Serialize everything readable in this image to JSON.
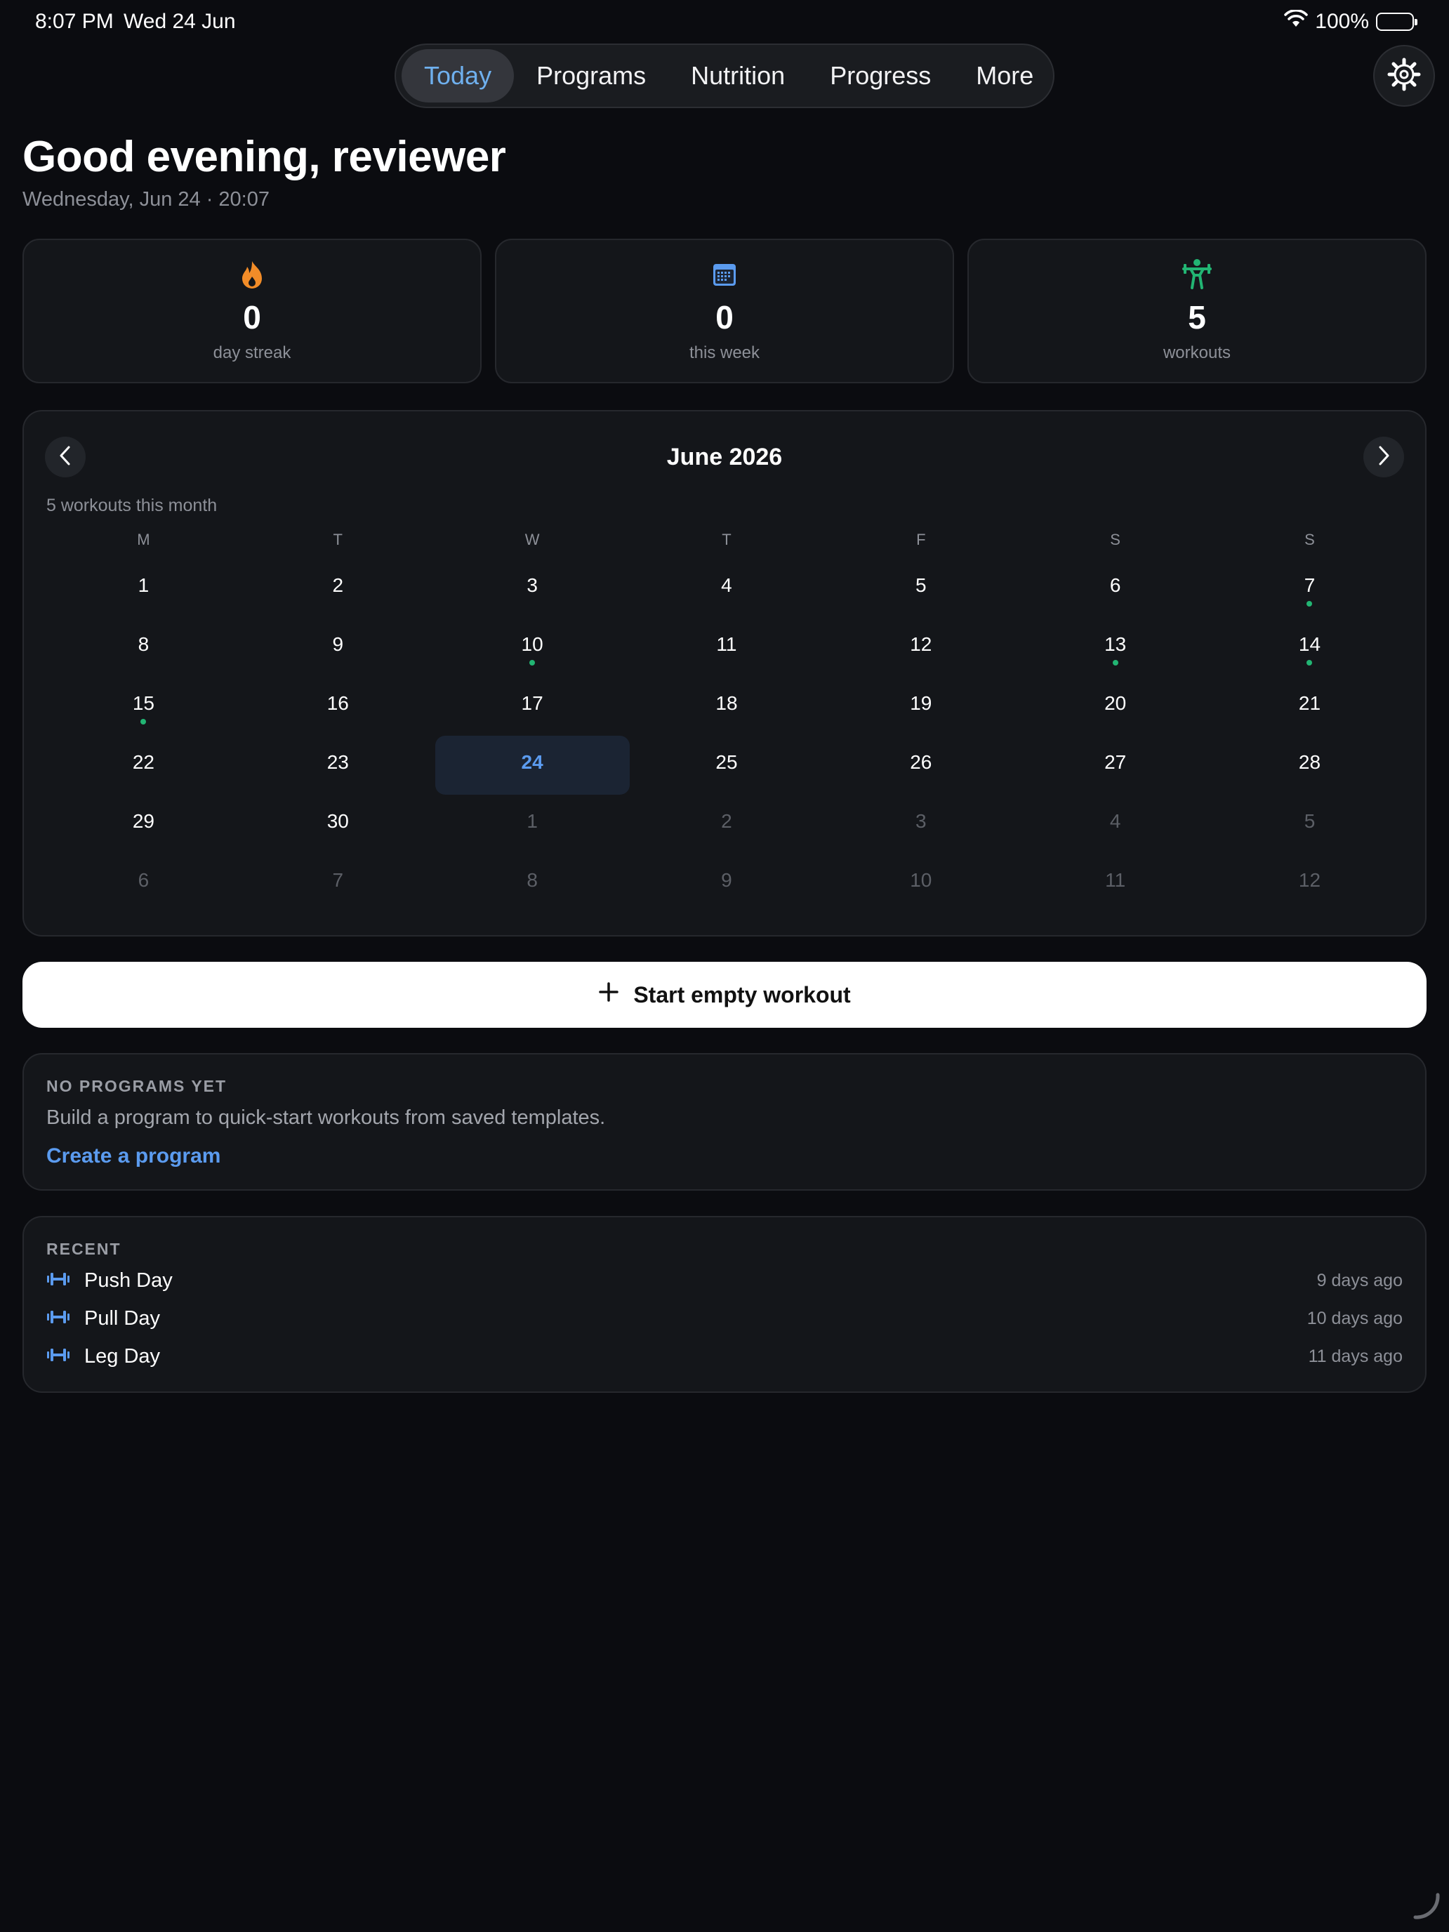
{
  "status": {
    "time": "8:07 PM",
    "date": "Wed 24 Jun",
    "battery": "100%"
  },
  "tabs": [
    {
      "label": "Today",
      "active": true
    },
    {
      "label": "Programs"
    },
    {
      "label": "Nutrition"
    },
    {
      "label": "Progress"
    },
    {
      "label": "More"
    }
  ],
  "header": {
    "greeting": "Good evening, reviewer",
    "date_line": "Wednesday, Jun 24 · 20:07"
  },
  "stats": [
    {
      "icon": "flame-icon",
      "value": "0",
      "label": "day streak",
      "color": "#f28c28"
    },
    {
      "icon": "calendar-icon",
      "value": "0",
      "label": "this week",
      "color": "#5b9bef"
    },
    {
      "icon": "weightlifter-icon",
      "value": "5",
      "label": "workouts",
      "color": "#22b573"
    }
  ],
  "calendar": {
    "title": "June 2026",
    "subtitle": "5 workouts this month",
    "weekdays": [
      "M",
      "T",
      "W",
      "T",
      "F",
      "S",
      "S"
    ],
    "weeks": [
      [
        {
          "d": "1"
        },
        {
          "d": "2"
        },
        {
          "d": "3"
        },
        {
          "d": "4"
        },
        {
          "d": "5"
        },
        {
          "d": "6"
        },
        {
          "d": "7",
          "dot": true
        }
      ],
      [
        {
          "d": "8"
        },
        {
          "d": "9"
        },
        {
          "d": "10",
          "dot": true
        },
        {
          "d": "11"
        },
        {
          "d": "12"
        },
        {
          "d": "13",
          "dot": true
        },
        {
          "d": "14",
          "dot": true
        }
      ],
      [
        {
          "d": "15",
          "dot": true
        },
        {
          "d": "16"
        },
        {
          "d": "17"
        },
        {
          "d": "18"
        },
        {
          "d": "19"
        },
        {
          "d": "20"
        },
        {
          "d": "21"
        }
      ],
      [
        {
          "d": "22"
        },
        {
          "d": "23"
        },
        {
          "d": "24",
          "today": true
        },
        {
          "d": "25"
        },
        {
          "d": "26"
        },
        {
          "d": "27"
        },
        {
          "d": "28"
        }
      ],
      [
        {
          "d": "29"
        },
        {
          "d": "30"
        },
        {
          "d": "1",
          "other": true
        },
        {
          "d": "2",
          "other": true
        },
        {
          "d": "3",
          "other": true
        },
        {
          "d": "4",
          "other": true
        },
        {
          "d": "5",
          "other": true
        }
      ],
      [
        {
          "d": "6",
          "other": true
        },
        {
          "d": "7",
          "other": true
        },
        {
          "d": "8",
          "other": true
        },
        {
          "d": "9",
          "other": true
        },
        {
          "d": "10",
          "other": true
        },
        {
          "d": "11",
          "other": true
        },
        {
          "d": "12",
          "other": true
        }
      ]
    ]
  },
  "start_button": {
    "label": "Start empty workout"
  },
  "programs": {
    "section_label": "NO PROGRAMS YET",
    "description": "Build a program to quick-start workouts from saved templates.",
    "link": "Create a program"
  },
  "recent": {
    "section_label": "RECENT",
    "items": [
      {
        "name": "Push Day",
        "ago": "9 days ago"
      },
      {
        "name": "Pull Day",
        "ago": "10 days ago"
      },
      {
        "name": "Leg Day",
        "ago": "11 days ago"
      }
    ]
  },
  "colors": {
    "accent": "#5b9bef",
    "workout_dot": "#22b573",
    "background": "#0b0c10"
  }
}
